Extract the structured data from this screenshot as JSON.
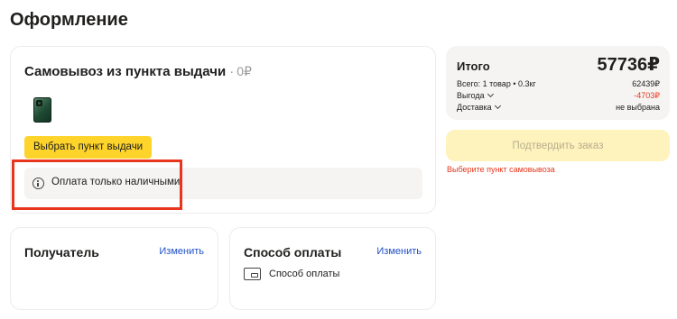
{
  "page": {
    "title": "Оформление"
  },
  "delivery": {
    "title": "Самовывоз из пункта выдачи",
    "separator": "·",
    "price": "0₽",
    "pickup_button": "Выбрать пункт выдачи",
    "notice": "Оплата только наличными"
  },
  "recipient": {
    "title": "Получатель",
    "change": "Изменить"
  },
  "payment": {
    "title": "Способ оплаты",
    "change": "Изменить",
    "method_label": "Способ оплаты"
  },
  "summary": {
    "total_label": "Итого",
    "total_value": "57736₽",
    "rows": [
      {
        "label": "Всего: 1 товар • 0.3кг",
        "value": "62439₽"
      },
      {
        "label": "Выгода",
        "value": "-4703₽"
      },
      {
        "label": "Доставка",
        "value": "не выбрана"
      }
    ]
  },
  "confirm": {
    "label": "Подтвердить заказ"
  },
  "error": {
    "text": "Выберите пункт самовывоза"
  },
  "colors": {
    "accent_yellow": "#fed42b",
    "link_blue": "#1f51c7",
    "error_red": "#e8361e",
    "highlight_border": "#e8361e"
  }
}
